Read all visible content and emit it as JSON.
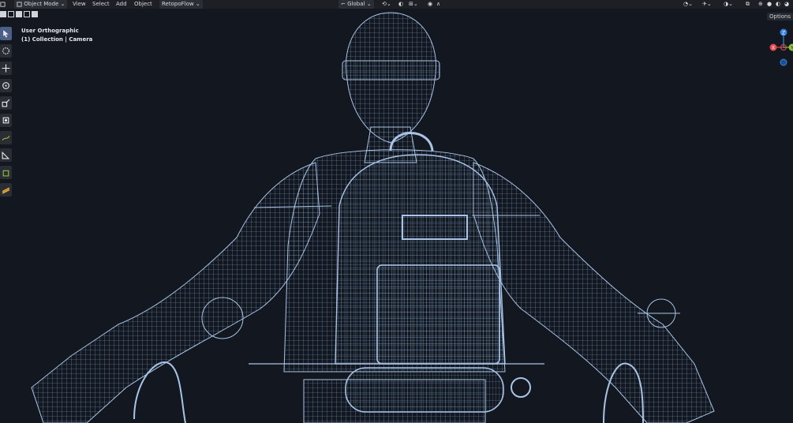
{
  "header": {
    "mode": "Object Mode",
    "menus": [
      "View",
      "Select",
      "Add",
      "Object"
    ],
    "addon": "RetopoFlow",
    "transform_orientation": "Global"
  },
  "viewport": {
    "view_name": "User Orthographic",
    "collection_info": "(1) Collection | Camera",
    "options_label": "Options"
  },
  "gizmo": {
    "x_label": "X",
    "y_label": "Y",
    "z_label": "Z"
  },
  "tools": [
    {
      "name": "select-box-icon"
    },
    {
      "name": "cursor-icon"
    },
    {
      "name": "move-icon"
    },
    {
      "name": "rotate-icon"
    },
    {
      "name": "scale-icon"
    },
    {
      "name": "transform-icon"
    },
    {
      "name": "annotate-icon"
    },
    {
      "name": "measure-icon"
    },
    {
      "name": "add-cube-icon"
    },
    {
      "name": "retopoflow-icon"
    }
  ],
  "colors": {
    "background": "#121720",
    "wire": "#8fb0d8",
    "gizmo_x": "#e5484d",
    "gizmo_y": "#8cc43f",
    "gizmo_z": "#3b82e0"
  }
}
